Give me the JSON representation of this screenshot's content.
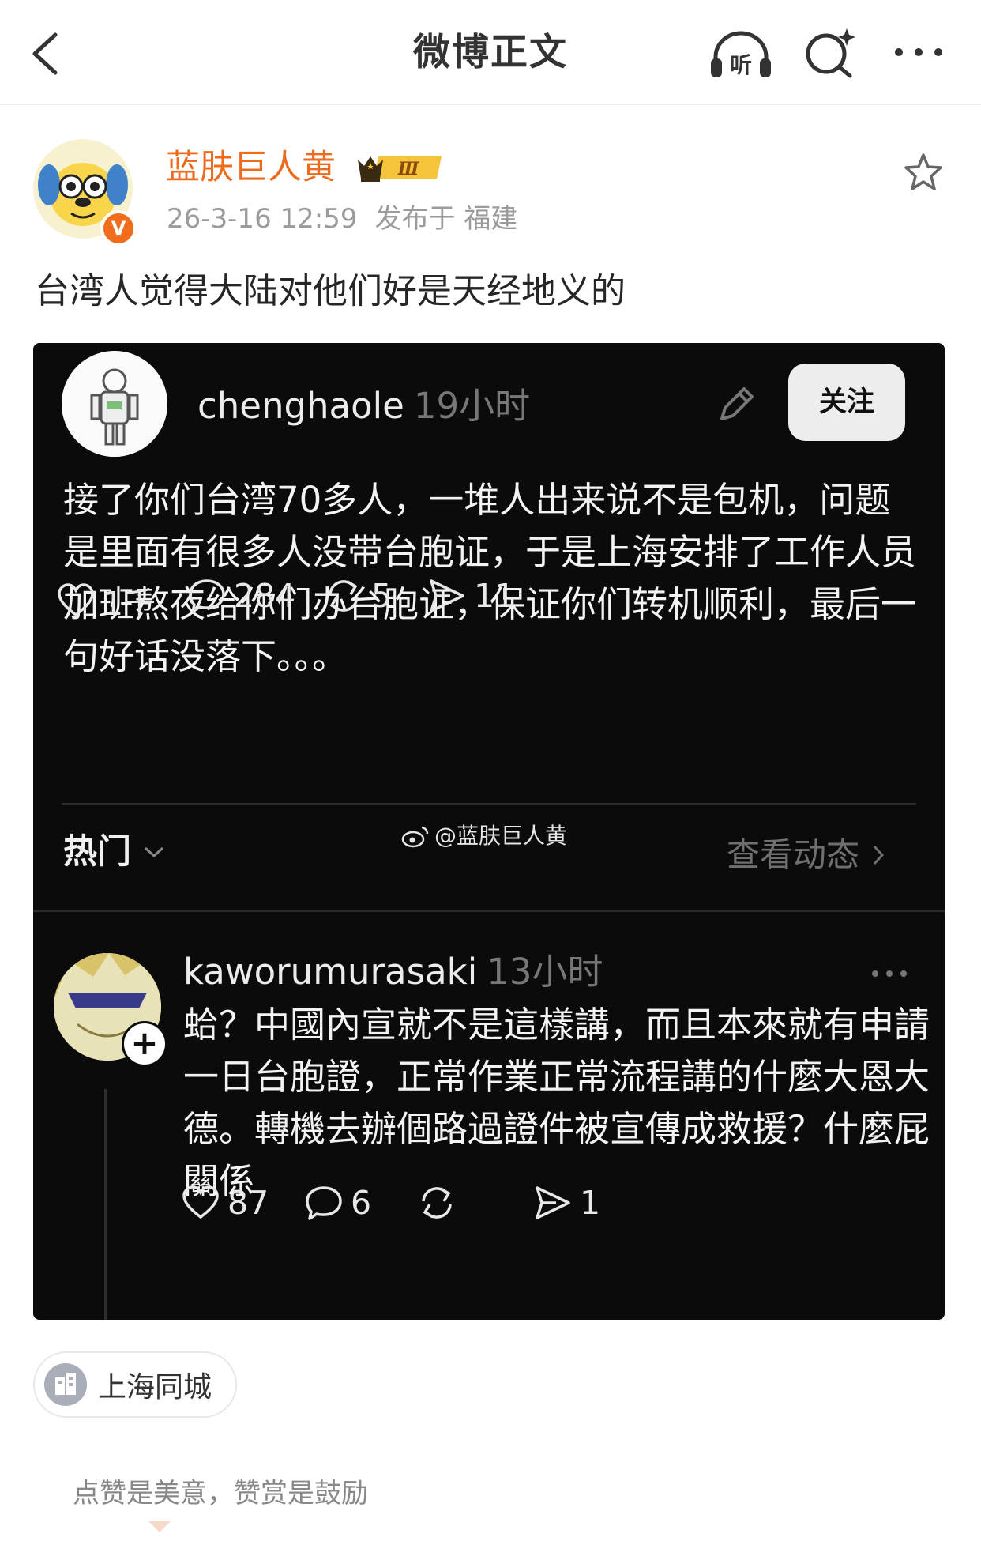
{
  "nav": {
    "title": "微博正文",
    "listen_label": "听"
  },
  "author": {
    "name": "蓝肤巨人黄",
    "vip_level": "Ⅲ",
    "verified_mark": "V",
    "date": "26-3-16 12:59",
    "location": "发布于 福建"
  },
  "post": {
    "text": "台湾人觉得大陆对他们好是天经地义的"
  },
  "embedded": {
    "username": "chenghaole",
    "time": "19小时",
    "follow_label": "关注",
    "body": "接了你们台湾70多人，一堆人出来说不是包机，问题是里面有很多人没带台胞证，于是上海安排了工作人员加班熬夜给你们办台胞证，保证你们转机顺利，最后一句好话没落下。。。",
    "stats": {
      "likes": "1千",
      "comments": "284",
      "reposts": "5",
      "shares": "11"
    },
    "sort_label": "热门",
    "watermark": "@蓝肤巨人黄",
    "view_activity": "查看动态",
    "reply": {
      "username": "kaworumurasaki",
      "time": "13小时",
      "body": "蛤？中國內宣就不是這樣講，而且本來就有申請一日台胞證，正常作業正常流程講的什麼大恩大德。轉機去辦個路過證件被宣傳成救援？什麼屁關係",
      "stats": {
        "likes": "87",
        "comments": "6",
        "shares": "1"
      }
    }
  },
  "topic": {
    "label": "上海同城"
  },
  "reward": {
    "text": "点赞是美意，赞赏是鼓励"
  },
  "colors": {
    "accent": "#ee6a1c",
    "card_bg": "#0b0b0b",
    "verified": "#f06d1c"
  }
}
